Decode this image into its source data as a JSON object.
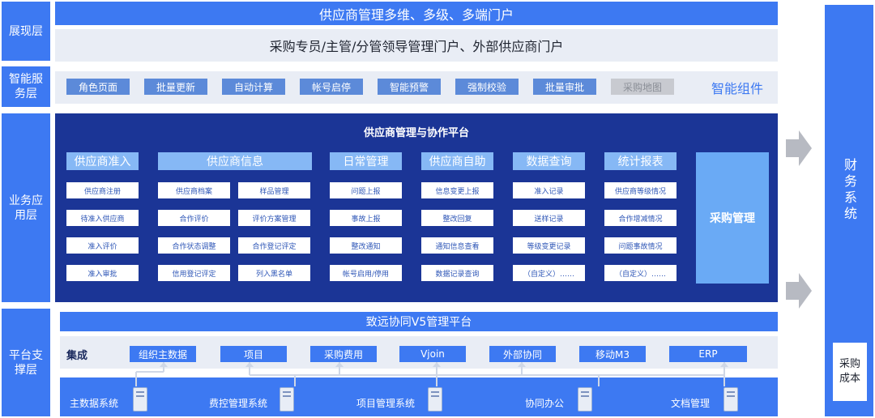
{
  "layers": {
    "presentation": "展现层",
    "smart_service": "智能服务层",
    "business": "业务应用层",
    "platform": "平台支撑层"
  },
  "presentation": {
    "banner": "供应商管理多维、多级、多端门户",
    "portal": "采购专员/主管/分管领导管理门户、外部供应商门户"
  },
  "smart_service": {
    "chips": [
      {
        "label": "角色页面",
        "enabled": true
      },
      {
        "label": "批量更新",
        "enabled": true
      },
      {
        "label": "自动计算",
        "enabled": true
      },
      {
        "label": "帐号启停",
        "enabled": true
      },
      {
        "label": "智能预警",
        "enabled": true
      },
      {
        "label": "强制校验",
        "enabled": true
      },
      {
        "label": "批量审批",
        "enabled": true
      },
      {
        "label": "采购地图",
        "enabled": false
      }
    ],
    "caption": "智能组件"
  },
  "business": {
    "title": "供应商管理与协作平台",
    "modules": [
      {
        "name": "供应商准入",
        "items": [
          "供应商注册",
          "待准入供应商",
          "准入评价",
          "准入审批"
        ]
      },
      {
        "name": "供应商信息",
        "items": [
          "供应商档案",
          "样品管理",
          "合作评价",
          "评价方案管理",
          "合作状态调整",
          "合作登记评定",
          "信用登记评定",
          "列入黑名单"
        ]
      },
      {
        "name": "日常管理",
        "items": [
          "问题上报",
          "事故上报",
          "整改通知",
          "帐号启用/停用"
        ]
      },
      {
        "name": "供应商自助",
        "items": [
          "信息变更上报",
          "整改回复",
          "通知信息查看",
          "数据记录查询"
        ]
      },
      {
        "name": "数据查询",
        "items": [
          "准入记录",
          "送样记录",
          "等级变更记录",
          "（自定义）……"
        ]
      },
      {
        "name": "统计报表",
        "items": [
          "供应商等级情况",
          "合作增减情况",
          "问题事故情况",
          "（自定义）……"
        ]
      }
    ],
    "procurement": "采购管理"
  },
  "platform": {
    "banner": "致远协同V5管理平台",
    "integration_label": "集成",
    "integrations": [
      "组织主数据",
      "项目",
      "采购费用",
      "Vjoin",
      "外部协同",
      "移动M3",
      "ERP"
    ],
    "systems": [
      "主数据系统",
      "费控管理系统",
      "项目管理系统",
      "协同办公",
      "文档管理"
    ]
  },
  "right_panel": {
    "finance": "财务系统",
    "cost": "采购成本"
  },
  "colors": {
    "primary_blue": "#3d79f2",
    "dark_navy": "#1b3596",
    "module_head": "#86b8f5",
    "chip_blue": "#5c8ad9",
    "procurement_box": "#6aaaf5",
    "light_band": "#e9edf5",
    "arrow_gray": "#b7bac2"
  }
}
